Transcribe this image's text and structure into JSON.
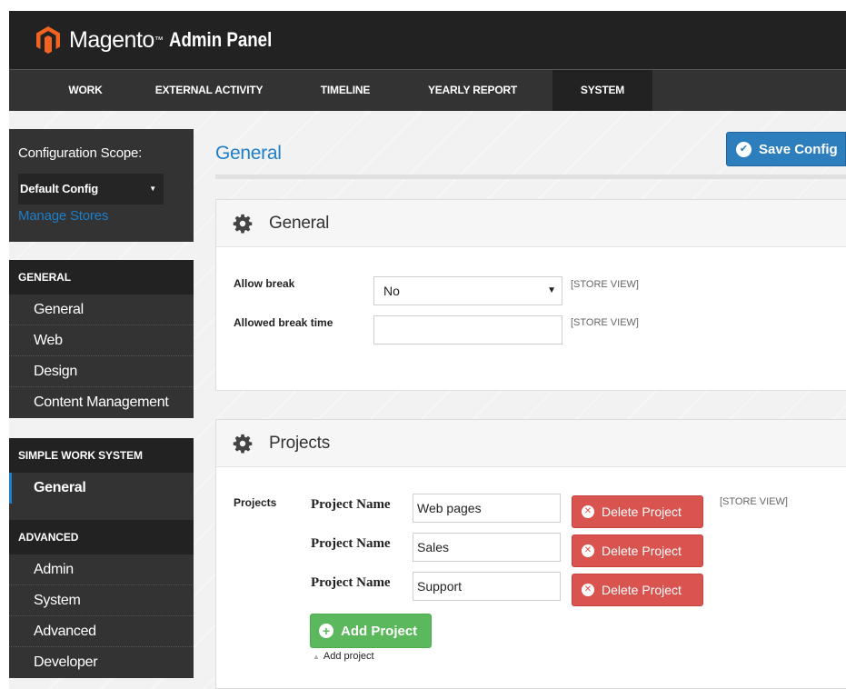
{
  "header": {
    "logo_text": "Magento",
    "logo_tm": "™",
    "logo_sub": "Admin Panel"
  },
  "nav": {
    "items": [
      {
        "label": "WORK"
      },
      {
        "label": "EXTERNAL ACTIVITY"
      },
      {
        "label": "TIMELINE"
      },
      {
        "label": "YEARLY REPORT"
      },
      {
        "label": "SYSTEM",
        "active": true
      }
    ]
  },
  "sidebar": {
    "scope_label": "Configuration Scope:",
    "scope_value": "Default Config",
    "manage_stores": "Manage Stores",
    "sections": [
      {
        "heading": "GENERAL",
        "items": [
          "General",
          "Web",
          "Design",
          "Content Management"
        ]
      },
      {
        "heading": "SIMPLE WORK SYSTEM",
        "items": [
          "General"
        ],
        "active_item": "General"
      },
      {
        "heading": "ADVANCED",
        "items": [
          "Admin",
          "System",
          "Advanced",
          "Developer"
        ]
      }
    ]
  },
  "main": {
    "page_title": "General",
    "save_button": "Save Config",
    "general_panel": {
      "title": "General",
      "allow_break_label": "Allow break",
      "allow_break_value": "No",
      "allowed_break_time_label": "Allowed break time",
      "allowed_break_time_value": "",
      "scope_tag": "[STORE VIEW]"
    },
    "projects_panel": {
      "title": "Projects",
      "field_label": "Projects",
      "project_name_label": "Project Name",
      "projects": [
        "Web pages",
        "Sales",
        "Support"
      ],
      "delete_label": "Delete Project",
      "add_label": "Add Project",
      "add_hint": "Add project",
      "scope_tag": "[STORE VIEW]"
    }
  },
  "colors": {
    "accent": "#1e7ec8",
    "topbar": "#222222",
    "navbar": "#333333",
    "danger": "#d9534f",
    "success": "#5cb85c",
    "logo": "#f26322"
  }
}
